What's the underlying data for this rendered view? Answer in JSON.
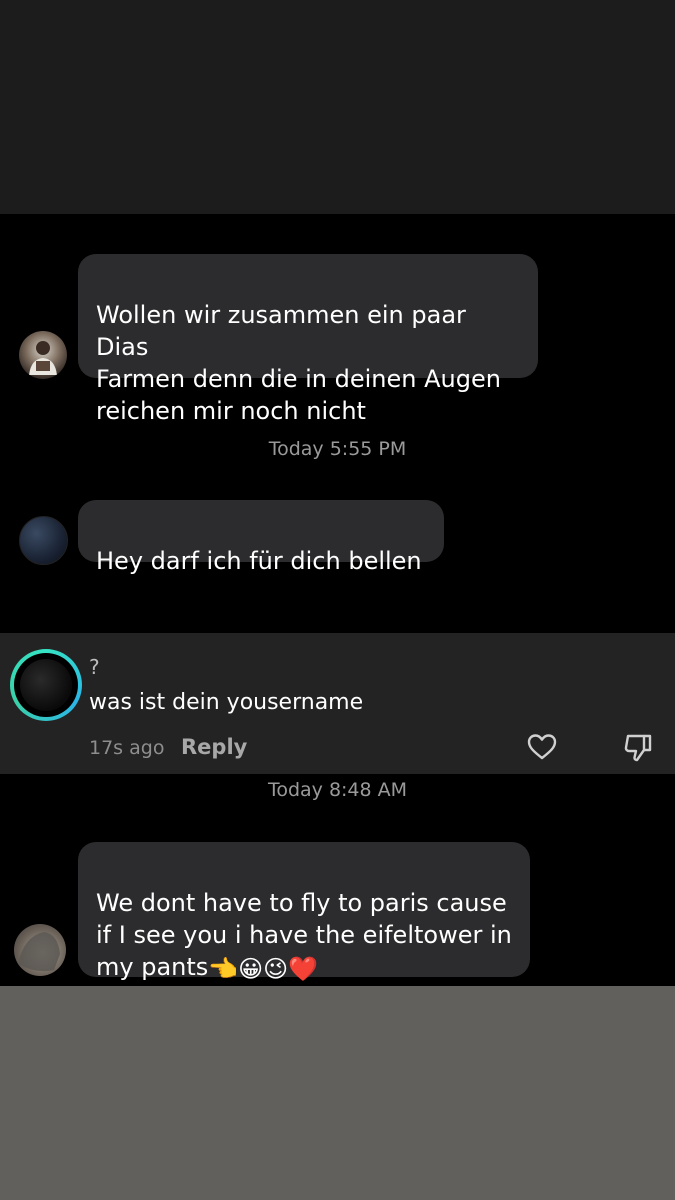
{
  "messages": [
    {
      "text": "Wollen wir zusammen ein paar Dias\nFarmen denn die in deinen Augen\nreichen mir noch nicht"
    },
    {
      "text": "Hey darf ich für dich bellen"
    },
    {
      "text": "We dont have to fly to paris cause\nif I see you i have the eifeltower in\nmy pants",
      "emojis": "👈😀😉❤️"
    }
  ],
  "timestamps": [
    "Today 5:55 PM",
    "Today 8:48 AM"
  ],
  "comment": {
    "username": "?",
    "text": "was ist dein yousername",
    "time": "17s ago",
    "reply_label": "Reply"
  },
  "icons": {
    "like": "heart-outline-icon",
    "dislike": "thumbs-down-icon"
  },
  "colors": {
    "bubble": "#2c2c2e",
    "ring_accent": "#35e3c4",
    "background": "#000000",
    "top_band": "#1c1c1c",
    "bottom_band": "#61605c"
  }
}
